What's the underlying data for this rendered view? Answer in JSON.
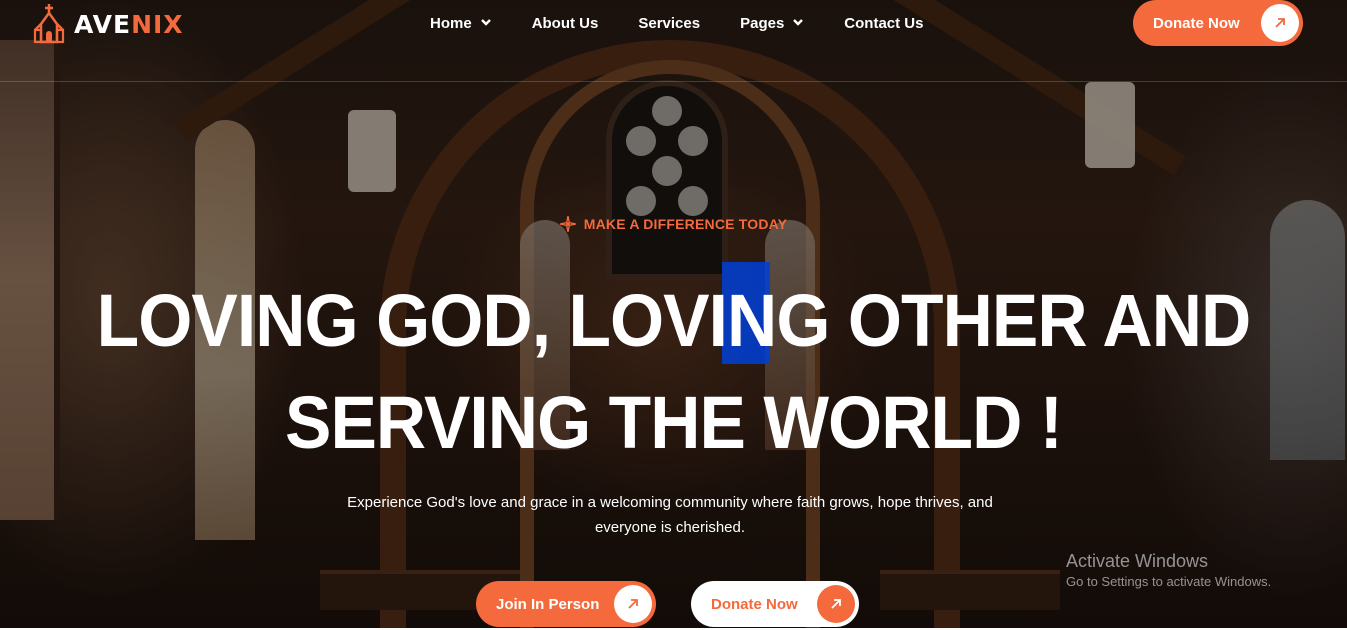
{
  "brand": {
    "name_part1": "AVE",
    "name_part2": "NIX"
  },
  "nav": {
    "items": [
      {
        "label": "Home",
        "has_dropdown": true
      },
      {
        "label": "About Us",
        "has_dropdown": false
      },
      {
        "label": "Services",
        "has_dropdown": false
      },
      {
        "label": "Pages",
        "has_dropdown": true
      },
      {
        "label": "Contact Us",
        "has_dropdown": false
      }
    ]
  },
  "header": {
    "cta_label": "Donate Now"
  },
  "hero": {
    "tagline": "MAKE A DIFFERENCE TODAY",
    "headline_line1": "LOVING GOD, LOVING OTHER AND",
    "headline_line2": "SERVING THE WORLD !",
    "description": "Experience God's love and grace in a welcoming community where faith grows, hope thrives, and everyone is cherished.",
    "primary_button": "Join In Person",
    "secondary_button": "Donate Now"
  },
  "watermark": {
    "title": "Activate Windows",
    "subtitle": "Go to Settings to activate Windows."
  },
  "colors": {
    "accent": "#f46a3c",
    "text": "#ffffff",
    "selection": "#0040d7"
  },
  "icons": [
    "church-logo-icon",
    "chevron-down-icon",
    "arrow-up-right-icon",
    "compass-star-icon"
  ]
}
